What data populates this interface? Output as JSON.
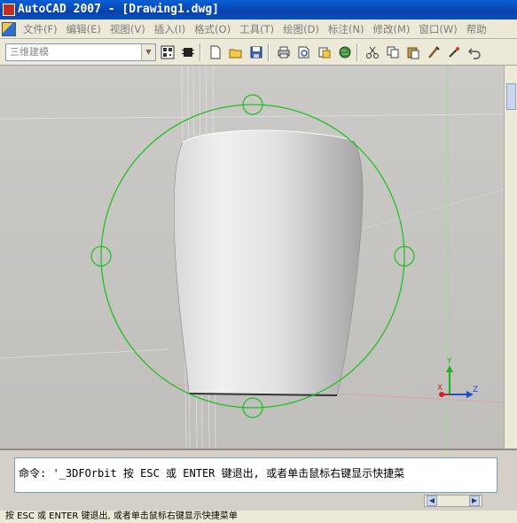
{
  "window": {
    "title": "AutoCAD 2007 - [Drawing1.dwg]"
  },
  "menu": {
    "items": [
      "文件(F)",
      "编辑(E)",
      "视图(V)",
      "插入(I)",
      "格式(O)",
      "工具(T)",
      "绘图(D)",
      "标注(N)",
      "修改(M)",
      "窗口(W)",
      "帮助"
    ]
  },
  "toolbar": {
    "workspace_value": "三维建模",
    "icons": [
      "qr-icon",
      "chip-icon",
      "new-icon",
      "open-icon",
      "save-icon",
      "print-icon",
      "preview-icon",
      "publish-icon",
      "globe-icon",
      "cut-icon",
      "copy-icon",
      "paste-icon",
      "brush-icon",
      "match-icon",
      "undo-icon"
    ]
  },
  "viewport": {
    "orbit_color": "#22c022",
    "axis": {
      "x": "X",
      "y": "Y",
      "z": "Z"
    }
  },
  "command": {
    "line": "命令: '_3DFOrbit 按 ESC 或 ENTER 键退出, 或者单击鼠标右键显示快捷菜"
  },
  "status": {
    "text": "按 ESC 或 ENTER 键退出, 或者单击鼠标右键显示快捷菜单"
  }
}
